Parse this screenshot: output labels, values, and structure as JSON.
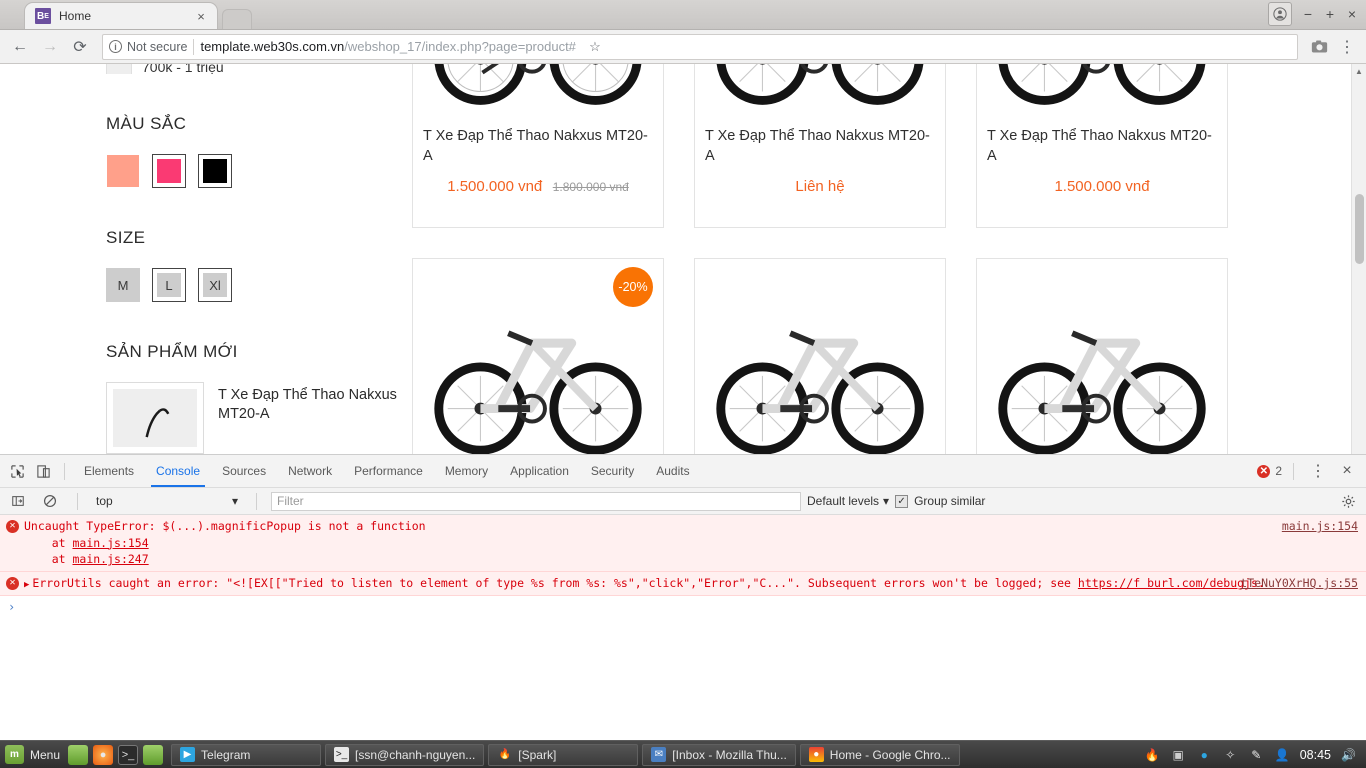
{
  "browser": {
    "tab": {
      "title": "Home",
      "favicon_letter": "B",
      "favicon_sub": "E",
      "close": "×"
    },
    "window_controls": {
      "minimize": "−",
      "maximize": "+",
      "close": "×"
    },
    "nav": {
      "back": "←",
      "forward": "→",
      "reload": "⟳"
    },
    "omnibox": {
      "security_text": "Not secure",
      "info_glyph": "i",
      "url_host": "template.web30s.com.vn",
      "url_path": "/webshop_17/index.php?page=product#",
      "bookmark_icon": "☆",
      "camera_icon": "camera",
      "menu_icon": "⋮"
    }
  },
  "page": {
    "clipped_filter": {
      "label": "700k - 1 triệu"
    },
    "color_section": {
      "title": "MÀU SẮC",
      "swatches": [
        {
          "name": "peach",
          "hex": "#ffa08a",
          "selected": true
        },
        {
          "name": "pink",
          "hex": "#fa3a73",
          "selected": false
        },
        {
          "name": "black",
          "hex": "#000000",
          "selected": false
        }
      ]
    },
    "size_section": {
      "title": "SIZE",
      "sizes": [
        {
          "label": "M",
          "selected": true
        },
        {
          "label": "L",
          "selected": false
        },
        {
          "label": "Xl",
          "selected": false
        }
      ]
    },
    "new_products_section": {
      "title": "SẢN PHẨM MỚI",
      "items": [
        {
          "name": "T Xe Đạp Thể Thao Nakxus MT20-A"
        }
      ]
    },
    "products": [
      {
        "title": "T Xe Đạp Thể Thao Nakxus MT20-A",
        "price": "1.500.000 vnđ",
        "old_price": "1.800.000 vnđ",
        "badge": ""
      },
      {
        "title": "T Xe Đạp Thể Thao Nakxus MT20-A",
        "price": "Liên hệ",
        "old_price": "",
        "badge": ""
      },
      {
        "title": "T Xe Đạp Thể Thao Nakxus MT20-A",
        "price": "1.500.000 vnđ",
        "old_price": "",
        "badge": ""
      },
      {
        "title": "",
        "price": "",
        "old_price": "",
        "badge": "-20%"
      },
      {
        "title": "",
        "price": "",
        "old_price": "",
        "badge": ""
      },
      {
        "title": "",
        "price": "",
        "old_price": "",
        "badge": ""
      }
    ],
    "accent_color": "#f26322",
    "badge_color": "#f97304"
  },
  "devtools": {
    "tools": {
      "inspect_icon": "inspect",
      "device_icon": "device"
    },
    "tabs": [
      {
        "label": "Elements",
        "active": false
      },
      {
        "label": "Console",
        "active": true
      },
      {
        "label": "Sources",
        "active": false
      },
      {
        "label": "Network",
        "active": false
      },
      {
        "label": "Performance",
        "active": false
      },
      {
        "label": "Memory",
        "active": false
      },
      {
        "label": "Application",
        "active": false
      },
      {
        "label": "Security",
        "active": false
      },
      {
        "label": "Audits",
        "active": false
      }
    ],
    "error_count": "2",
    "more_icon": "⋮",
    "close_icon": "×",
    "filterbar": {
      "sidebar_toggle": "sidebar",
      "clear_console": "⊘",
      "context": "top",
      "context_caret": "▾",
      "filter_placeholder": "Filter",
      "filter_value": "",
      "levels": "Default levels",
      "levels_caret": "▾",
      "group_similar": "Group similar",
      "group_similar_checked": true,
      "settings_icon": "gear"
    },
    "messages": [
      {
        "icon": "error",
        "text": "Uncaught TypeError: $(...).magnificPopup is not a function",
        "stack": [
          {
            "prefix": "    at ",
            "link": "main.js:154"
          },
          {
            "prefix": "    at ",
            "link": "main.js:247"
          }
        ],
        "source": "main.js:154",
        "expandable": false
      },
      {
        "icon": "error",
        "text": "ErrorUtils caught an error: \"<![EX[[\"Tried to listen to element of type %s from %s: %s\",\"click\",\"Error\",\"C...\". Subsequent errors won't be logged; see ",
        "link_text": "https://f burl.com/debugjs",
        "text_tail": ".",
        "source": "tTeNuY0XrHQ.js:55",
        "expandable": true
      }
    ],
    "prompt": "›"
  },
  "taskbar": {
    "menu_label": "Menu",
    "mint_letter": "m",
    "quick_launch": [
      {
        "name": "show-desktop-icon"
      },
      {
        "name": "firefox-icon"
      },
      {
        "name": "terminal-icon"
      },
      {
        "name": "files-icon"
      }
    ],
    "windows": [
      {
        "label": "Telegram",
        "icon": "telegram-icon"
      },
      {
        "label": "[ssn@chanh-nguyen...",
        "icon": "terminal-icon"
      },
      {
        "label": "[Spark]",
        "icon": "spark-icon"
      },
      {
        "label": "[Inbox - Mozilla Thu...",
        "icon": "thunderbird-icon"
      },
      {
        "label": "Home - Google Chro...",
        "icon": "chrome-icon"
      }
    ],
    "tray": [
      {
        "name": "spark-tray-icon"
      },
      {
        "name": "archive-tray-icon"
      },
      {
        "name": "telegram-tray-icon"
      },
      {
        "name": "update-tray-icon"
      },
      {
        "name": "pen-tray-icon"
      },
      {
        "name": "user-tray-icon"
      }
    ],
    "clock": "08:45",
    "volume_icon": "🔊"
  }
}
